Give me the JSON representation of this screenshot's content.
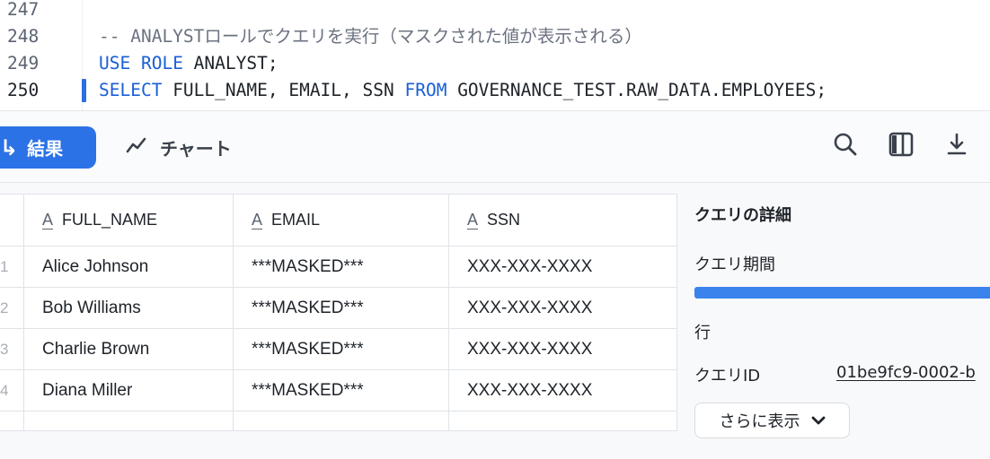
{
  "editor": {
    "lines": [
      {
        "number": "247",
        "tokens": []
      },
      {
        "number": "248",
        "tokens": [
          {
            "t": "-- ANALYSTロールでクエリを実行（マスクされた値が表示される）",
            "k": "cm"
          }
        ]
      },
      {
        "number": "249",
        "tokens": [
          {
            "t": "USE ",
            "k": "kw"
          },
          {
            "t": "ROLE",
            "k": "kw"
          },
          {
            "t": " ANALYST;",
            "k": "id"
          }
        ]
      },
      {
        "number": "250",
        "tokens": [
          {
            "t": "SELECT",
            "k": "kw"
          },
          {
            "t": " FULL_NAME, EMAIL, SSN ",
            "k": "id"
          },
          {
            "t": "FROM",
            "k": "kw"
          },
          {
            "t": " GOVERNANCE_TEST.RAW_DATA.EMPLOYEES;",
            "k": "id"
          }
        ]
      }
    ],
    "active_line": 3
  },
  "toolbar": {
    "results_label": "結果",
    "chart_label": "チャート",
    "icons": [
      "search-icon",
      "columns-icon",
      "download-icon"
    ]
  },
  "table": {
    "columns": [
      "FULL_NAME",
      "EMAIL",
      "SSN"
    ],
    "column_type_icon": "A",
    "rows": [
      {
        "idx": "1",
        "full_name": "Alice Johnson",
        "email": "***MASKED***",
        "ssn": "XXX-XXX-XXXX"
      },
      {
        "idx": "2",
        "full_name": "Bob Williams",
        "email": "***MASKED***",
        "ssn": "XXX-XXX-XXXX"
      },
      {
        "idx": "3",
        "full_name": "Charlie Brown",
        "email": "***MASKED***",
        "ssn": "XXX-XXX-XXXX"
      },
      {
        "idx": "4",
        "full_name": "Diana Miller",
        "email": "***MASKED***",
        "ssn": "XXX-XXX-XXXX"
      }
    ]
  },
  "details": {
    "title": "クエリの詳細",
    "duration_label": "クエリ期間",
    "duration_fill": 1.0,
    "rows_label": "行",
    "query_id_label": "クエリID",
    "query_id_value": "01be9fc9-0002-b",
    "show_more_label": "さらに表示"
  },
  "colors": {
    "accent": "#2b72e6",
    "keyword": "#1a5fd6",
    "comment": "#6b7280",
    "bar": "#3a83ec"
  }
}
